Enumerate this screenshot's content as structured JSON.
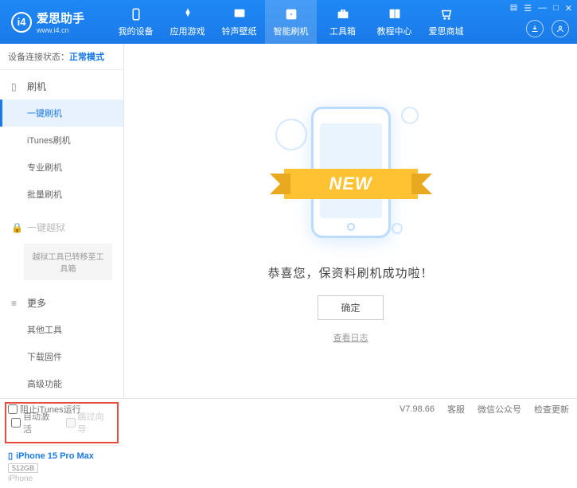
{
  "app": {
    "title": "爱思助手",
    "subtitle": "www.i4.cn",
    "logo_letter": "i4"
  },
  "nav": [
    {
      "label": "我的设备"
    },
    {
      "label": "应用游戏"
    },
    {
      "label": "铃声壁纸"
    },
    {
      "label": "智能刷机",
      "active": true
    },
    {
      "label": "工具箱"
    },
    {
      "label": "教程中心"
    },
    {
      "label": "爱思商城"
    }
  ],
  "window_controls": {
    "settings": "☰",
    "min": "—",
    "max": "□",
    "close": "✕"
  },
  "status": {
    "prefix": "设备连接状态：",
    "mode": "正常模式"
  },
  "sidebar": {
    "flash": {
      "header": "刷机",
      "items": [
        "一键刷机",
        "iTunes刷机",
        "专业刷机",
        "批量刷机"
      ],
      "active_index": 0
    },
    "jailbreak": {
      "header": "一键越狱",
      "note": "越狱工具已转移至工具箱"
    },
    "more": {
      "header": "更多",
      "items": [
        "其他工具",
        "下载固件",
        "高级功能"
      ]
    },
    "options": {
      "auto_activate": "自动激活",
      "skip_guide": "跳过向导"
    },
    "device": {
      "name": "iPhone 15 Pro Max",
      "storage": "512GB",
      "type": "iPhone"
    }
  },
  "main": {
    "ribbon": "NEW",
    "message": "恭喜您，保资料刷机成功啦！",
    "ok": "确定",
    "log": "查看日志"
  },
  "footer": {
    "block_itunes": "阻止iTunes运行",
    "version": "V7.98.66",
    "links": [
      "客服",
      "微信公众号",
      "检查更新"
    ]
  }
}
